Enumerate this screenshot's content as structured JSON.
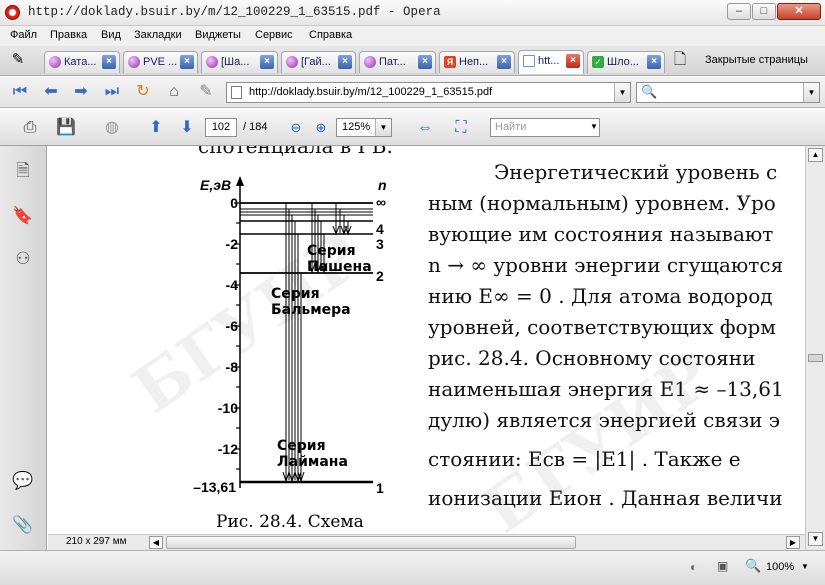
{
  "window": {
    "title": "http://doklady.bsuir.by/m/12_100229_1_63515.pdf - Opera"
  },
  "menu": [
    "Файл",
    "Правка",
    "Вид",
    "Закладки",
    "Виджеты",
    "Сервис",
    "Справка"
  ],
  "tabs": [
    {
      "label": "Ката..."
    },
    {
      "label": "PVE ..."
    },
    {
      "label": "[Ша..."
    },
    {
      "label": "[Гай..."
    },
    {
      "label": "Пат..."
    },
    {
      "label": "Неп..."
    },
    {
      "label": "htt..."
    },
    {
      "label": "Шло..."
    }
  ],
  "closed_tabs_label": "Закрытые страницы",
  "address": {
    "url": "http://doklady.bsuir.by/m/12_100229_1_63515.pdf"
  },
  "pdf_toolbar": {
    "page": "102",
    "total": "/ 184",
    "zoom": "125%",
    "find_placeholder": "Найти"
  },
  "document": {
    "top_cut": "спотенциала в I В.",
    "figure": {
      "y_axis_title": "E,эВ",
      "n_title": "n",
      "y_ticks": [
        "0",
        "-2",
        "-4",
        "-6",
        "-8",
        "-10",
        "-12",
        "–13,61"
      ],
      "n_labels": [
        "∞",
        "4",
        "3",
        "2",
        "1"
      ],
      "series_labels": [
        "Серия\nПашена",
        "Серия\nБальмера",
        "Серия\nЛаймана"
      ],
      "caption": "Рис. 28.4. Схема"
    },
    "lines": [
      "Энергетический уровень с",
      "ным (нормальным) уровнем. Уро",
      "вующие им состояния называют",
      "n → ∞  уровни энергии сгущаются",
      "нию  E∞ = 0 . Для атома водород",
      "уровней, соответствующих форм",
      "рис. 28.4. Основному состояни",
      "наименьшая энергия  E1 ≈ –13,61",
      "дулю) является энергией связи э",
      "стоянии:   Eсв = |E1| .   Также   е",
      "ионизации  Eион . Данная величи"
    ]
  },
  "status": {
    "page_size": "210 x 297 мм",
    "zoom": "100%"
  }
}
